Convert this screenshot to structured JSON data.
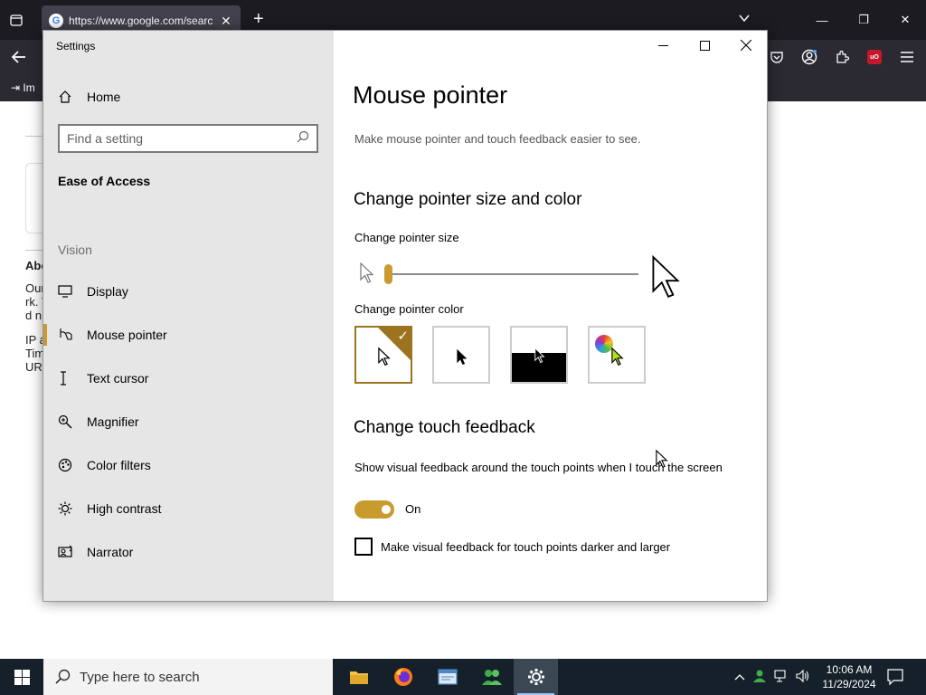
{
  "browser": {
    "tab_title": "https://www.google.com/search",
    "favicon": "G",
    "bookmark_import": "Im",
    "page_fragments": {
      "heading": "Abo",
      "line1": "Our",
      "line2": "rk. T",
      "line3": "d n",
      "line4": "IP a",
      "line5": "Tim",
      "line6": "UR"
    }
  },
  "settings": {
    "window_title": "Settings",
    "home_label": "Home",
    "search_placeholder": "Find a setting",
    "section_title": "Ease of Access",
    "group_header": "Vision",
    "nav_items": [
      {
        "label": "Display",
        "icon": "display-icon"
      },
      {
        "label": "Mouse pointer",
        "icon": "mouse-pointer-icon"
      },
      {
        "label": "Text cursor",
        "icon": "text-cursor-icon"
      },
      {
        "label": "Magnifier",
        "icon": "magnifier-icon"
      },
      {
        "label": "Color filters",
        "icon": "color-filters-icon"
      },
      {
        "label": "High contrast",
        "icon": "high-contrast-icon"
      },
      {
        "label": "Narrator",
        "icon": "narrator-icon"
      }
    ],
    "selected_item": "Mouse pointer",
    "content": {
      "title": "Mouse pointer",
      "description": "Make mouse pointer and touch feedback easier to see.",
      "size_color_heading": "Change pointer size and color",
      "size_label": "Change pointer size",
      "pointer_size_value": 1,
      "color_label": "Change pointer color",
      "color_options": [
        "white",
        "black",
        "inverted",
        "custom"
      ],
      "selected_color": "white",
      "touch_heading": "Change touch feedback",
      "touch_description": "Show visual feedback around the touch points when I touch the screen",
      "toggle_state": "On",
      "checkbox_label": "Make visual feedback for touch points darker and larger",
      "checkbox_checked": false
    }
  },
  "taskbar": {
    "search_placeholder": "Type here to search",
    "apps": [
      "file-explorer-icon",
      "firefox-icon",
      "notepad-icon",
      "people-app-icon",
      "settings-gear-icon"
    ],
    "time": "10:06 AM",
    "date": "11/29/2024"
  },
  "colors": {
    "accent": "#c99a2e",
    "accent_dark": "#9c7420",
    "sidebar_bg": "#e6e6e6",
    "taskbar_bg": "#15202b",
    "browser_bg": "#1c1b22"
  }
}
